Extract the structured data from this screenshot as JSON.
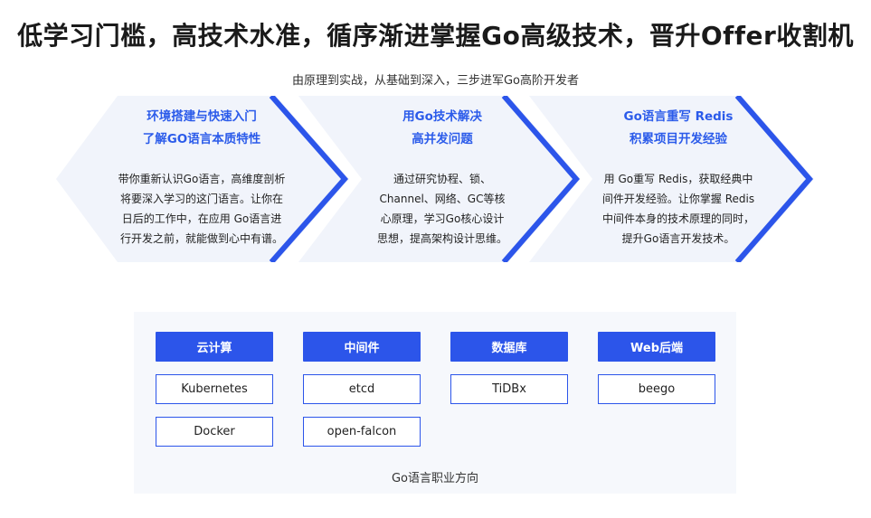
{
  "headline": "低学习门槛，高技术水准，循序渐进掌握Go高级技术，晋升Offer收割机",
  "subline": "由原理到实战，从基础到深入，三步进军Go高阶开发者",
  "steps": [
    {
      "title_line1": "环境搭建与快速入门",
      "title_line2": "了解GO语言本质特性",
      "desc_lines": [
        "带你重新认识Go语言，高维度剖析",
        "将要深入学习的这门语言。让你在",
        "日后的工作中，在应用 Go语言进",
        "行开发之前，就能做到心中有谱。"
      ]
    },
    {
      "title_line1": "用Go技术解决",
      "title_line2": "高并发问题",
      "desc_lines": [
        "通过研究协程、锁、",
        "Channel、网络、GC等核",
        "心原理，学习Go核心设计",
        "思想，提高架构设计思维。"
      ]
    },
    {
      "title_line1": "Go语言重写 Redis",
      "title_line2": "积累项目开发经验",
      "desc_lines": [
        "用 Go重写 Redis，获取经典中",
        "间件开发经验。让你掌握 Redis",
        "中间件本身的技术原理的同时，",
        "提升Go语言开发技术。"
      ]
    }
  ],
  "colors": {
    "accent": "#2c55ea",
    "step_bg": "#f1f4fb",
    "panel_bg": "#f6f8fc"
  },
  "career": {
    "columns": [
      {
        "head": "云计算",
        "items": [
          "Kubernetes",
          "Docker"
        ]
      },
      {
        "head": "中间件",
        "items": [
          "etcd",
          "open-falcon"
        ]
      },
      {
        "head": "数据库",
        "items": [
          "TiDBx"
        ]
      },
      {
        "head": "Web后端",
        "items": [
          "beego"
        ]
      }
    ],
    "caption": "Go语言职业方向"
  }
}
